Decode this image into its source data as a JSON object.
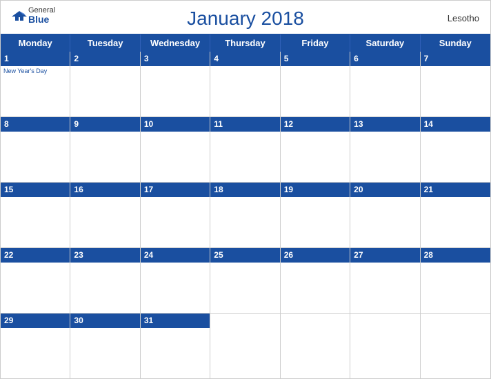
{
  "header": {
    "title": "January 2018",
    "country": "Lesotho",
    "logo": {
      "general": "General",
      "blue": "Blue"
    }
  },
  "days_of_week": [
    "Monday",
    "Tuesday",
    "Wednesday",
    "Thursday",
    "Friday",
    "Saturday",
    "Sunday"
  ],
  "weeks": [
    [
      {
        "num": "1",
        "holiday": "New Year's Day"
      },
      {
        "num": "2",
        "holiday": ""
      },
      {
        "num": "3",
        "holiday": ""
      },
      {
        "num": "4",
        "holiday": ""
      },
      {
        "num": "5",
        "holiday": ""
      },
      {
        "num": "6",
        "holiday": ""
      },
      {
        "num": "7",
        "holiday": ""
      }
    ],
    [
      {
        "num": "8",
        "holiday": ""
      },
      {
        "num": "9",
        "holiday": ""
      },
      {
        "num": "10",
        "holiday": ""
      },
      {
        "num": "11",
        "holiday": ""
      },
      {
        "num": "12",
        "holiday": ""
      },
      {
        "num": "13",
        "holiday": ""
      },
      {
        "num": "14",
        "holiday": ""
      }
    ],
    [
      {
        "num": "15",
        "holiday": ""
      },
      {
        "num": "16",
        "holiday": ""
      },
      {
        "num": "17",
        "holiday": ""
      },
      {
        "num": "18",
        "holiday": ""
      },
      {
        "num": "19",
        "holiday": ""
      },
      {
        "num": "20",
        "holiday": ""
      },
      {
        "num": "21",
        "holiday": ""
      }
    ],
    [
      {
        "num": "22",
        "holiday": ""
      },
      {
        "num": "23",
        "holiday": ""
      },
      {
        "num": "24",
        "holiday": ""
      },
      {
        "num": "25",
        "holiday": ""
      },
      {
        "num": "26",
        "holiday": ""
      },
      {
        "num": "27",
        "holiday": ""
      },
      {
        "num": "28",
        "holiday": ""
      }
    ],
    [
      {
        "num": "29",
        "holiday": ""
      },
      {
        "num": "30",
        "holiday": ""
      },
      {
        "num": "31",
        "holiday": ""
      },
      {
        "num": "",
        "holiday": ""
      },
      {
        "num": "",
        "holiday": ""
      },
      {
        "num": "",
        "holiday": ""
      },
      {
        "num": "",
        "holiday": ""
      }
    ]
  ]
}
